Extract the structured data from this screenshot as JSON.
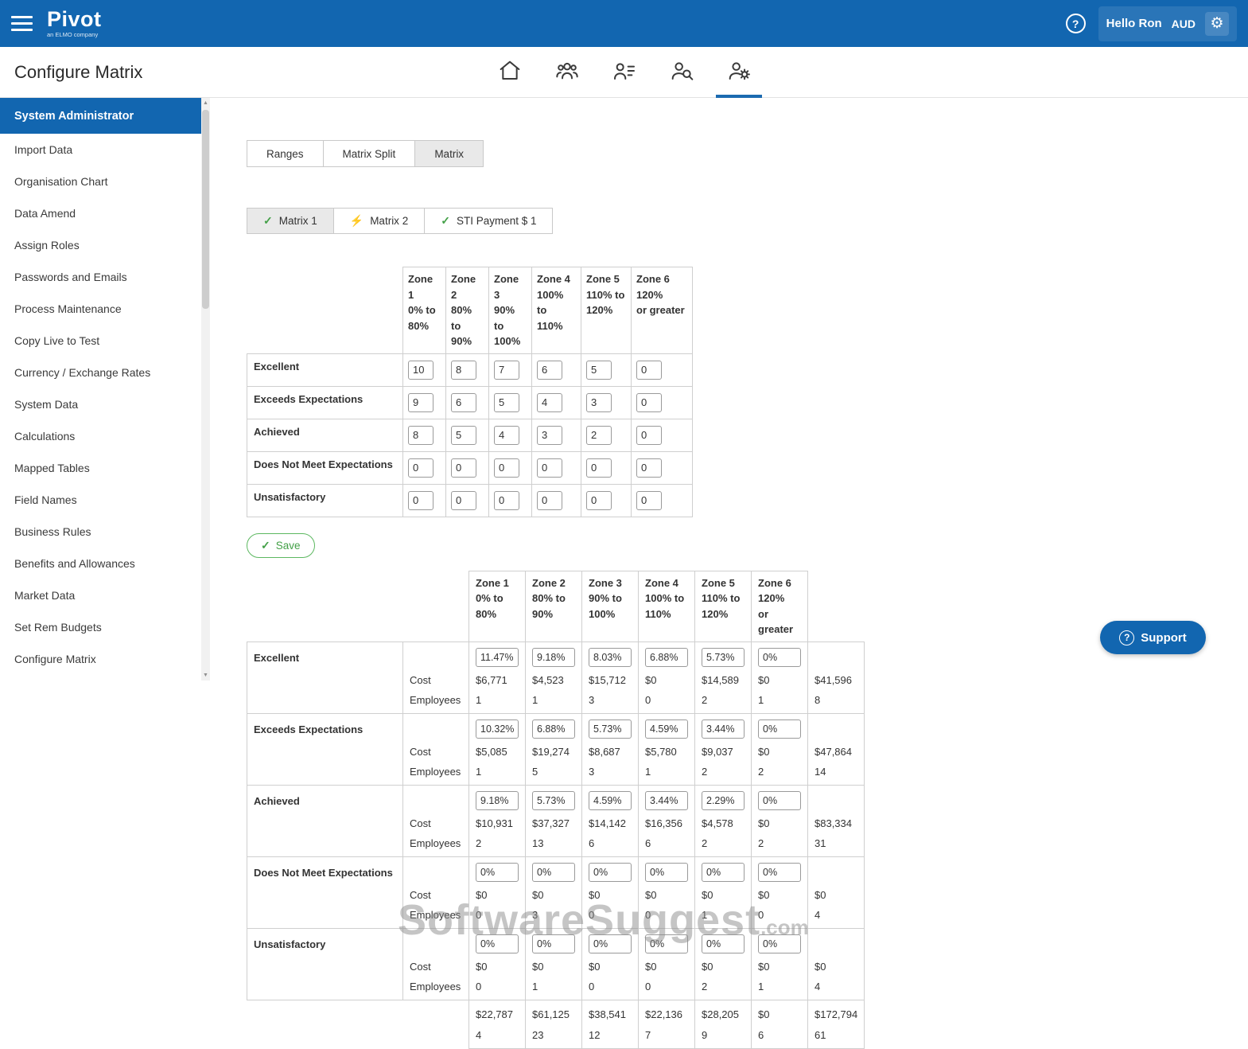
{
  "header": {
    "logo": "Pivot",
    "logo_sub": "an ELMO company",
    "greeting": "Hello Ron",
    "currency": "AUD"
  },
  "page": {
    "title": "Configure Matrix"
  },
  "nav_icons": [
    "home-icon",
    "employees-icon",
    "employee-list-icon",
    "employee-search-icon",
    "employee-settings-icon"
  ],
  "sidebar": {
    "header": "System Administrator",
    "items": [
      "Import Data",
      "Organisation Chart",
      "Data Amend",
      "Assign Roles",
      "Passwords and Emails",
      "Process Maintenance",
      "Copy Live to Test",
      "Currency / Exchange Rates",
      "System Data",
      "Calculations",
      "Mapped Tables",
      "Field Names",
      "Business Rules",
      "Benefits and Allowances",
      "Market Data",
      "Set Rem Budgets",
      "Configure Matrix"
    ]
  },
  "tabs": {
    "items": [
      "Ranges",
      "Matrix Split",
      "Matrix"
    ],
    "active": "Matrix"
  },
  "subtabs": {
    "items": [
      {
        "icon": "check-icon",
        "label": "Matrix 1"
      },
      {
        "icon": "lightning-icon",
        "label": "Matrix 2"
      },
      {
        "icon": "check-icon",
        "label": "STI Payment $ 1"
      }
    ],
    "active": "Matrix 1"
  },
  "zones": [
    "Zone 1\n0% to\n80%",
    "Zone 2\n80% to\n90%",
    "Zone 3\n90% to\n100%",
    "Zone 4\n100% to\n110%",
    "Zone 5\n110% to\n120%",
    "Zone 6\n120%\nor greater"
  ],
  "matrix1": {
    "save_label": "Save",
    "rows": [
      {
        "label": "Excellent",
        "values": [
          "10",
          "8",
          "7",
          "6",
          "5",
          "0"
        ]
      },
      {
        "label": "Exceeds Expectations",
        "values": [
          "9",
          "6",
          "5",
          "4",
          "3",
          "0"
        ]
      },
      {
        "label": "Achieved",
        "values": [
          "8",
          "5",
          "4",
          "3",
          "2",
          "0"
        ]
      },
      {
        "label": "Does Not Meet Expectations",
        "values": [
          "0",
          "0",
          "0",
          "0",
          "0",
          "0"
        ]
      },
      {
        "label": "Unsatisfactory",
        "values": [
          "0",
          "0",
          "0",
          "0",
          "0",
          "0"
        ]
      }
    ]
  },
  "matrix2": {
    "cost_label": "Cost",
    "employees_label": "Employees",
    "rows": [
      {
        "label": "Excellent",
        "percents": [
          "11.47%",
          "9.18%",
          "8.03%",
          "6.88%",
          "5.73%",
          "0%"
        ],
        "costs": [
          "$6,771",
          "$4,523",
          "$15,712",
          "$0",
          "$14,589",
          "$0"
        ],
        "employees": [
          "1",
          "1",
          "3",
          "0",
          "2",
          "1"
        ],
        "cost_total": "$41,596",
        "employees_total": "8"
      },
      {
        "label": "Exceeds Expectations",
        "percents": [
          "10.32%",
          "6.88%",
          "5.73%",
          "4.59%",
          "3.44%",
          "0%"
        ],
        "costs": [
          "$5,085",
          "$19,274",
          "$8,687",
          "$5,780",
          "$9,037",
          "$0"
        ],
        "employees": [
          "1",
          "5",
          "3",
          "1",
          "2",
          "2"
        ],
        "cost_total": "$47,864",
        "employees_total": "14"
      },
      {
        "label": "Achieved",
        "percents": [
          "9.18%",
          "5.73%",
          "4.59%",
          "3.44%",
          "2.29%",
          "0%"
        ],
        "costs": [
          "$10,931",
          "$37,327",
          "$14,142",
          "$16,356",
          "$4,578",
          "$0"
        ],
        "employees": [
          "2",
          "13",
          "6",
          "6",
          "2",
          "2"
        ],
        "cost_total": "$83,334",
        "employees_total": "31"
      },
      {
        "label": "Does Not Meet Expectations",
        "percents": [
          "0%",
          "0%",
          "0%",
          "0%",
          "0%",
          "0%"
        ],
        "costs": [
          "$0",
          "$0",
          "$0",
          "$0",
          "$0",
          "$0"
        ],
        "employees": [
          "0",
          "3",
          "0",
          "0",
          "1",
          "0"
        ],
        "cost_total": "$0",
        "employees_total": "4"
      },
      {
        "label": "Unsatisfactory",
        "percents": [
          "0%",
          "0%",
          "0%",
          "0%",
          "0%",
          "0%"
        ],
        "costs": [
          "$0",
          "$0",
          "$0",
          "$0",
          "$0",
          "$0"
        ],
        "employees": [
          "0",
          "1",
          "0",
          "0",
          "2",
          "1"
        ],
        "cost_total": "$0",
        "employees_total": "4"
      }
    ],
    "totals": {
      "costs": [
        "$22,787",
        "$61,125",
        "$38,541",
        "$22,136",
        "$28,205",
        "$0"
      ],
      "cost_grand": "$172,794",
      "employees": [
        "4",
        "23",
        "12",
        "7",
        "9",
        "6"
      ],
      "employees_grand": "61"
    }
  },
  "support": {
    "label": "Support"
  },
  "watermark": {
    "main": "SoftwareSuggest",
    "suffix": ".com"
  },
  "colors": {
    "brand_blue": "#1266b0",
    "active_underline": "#1b6ab0",
    "check_green": "#43a047",
    "lightning_orange": "#f5a623"
  }
}
